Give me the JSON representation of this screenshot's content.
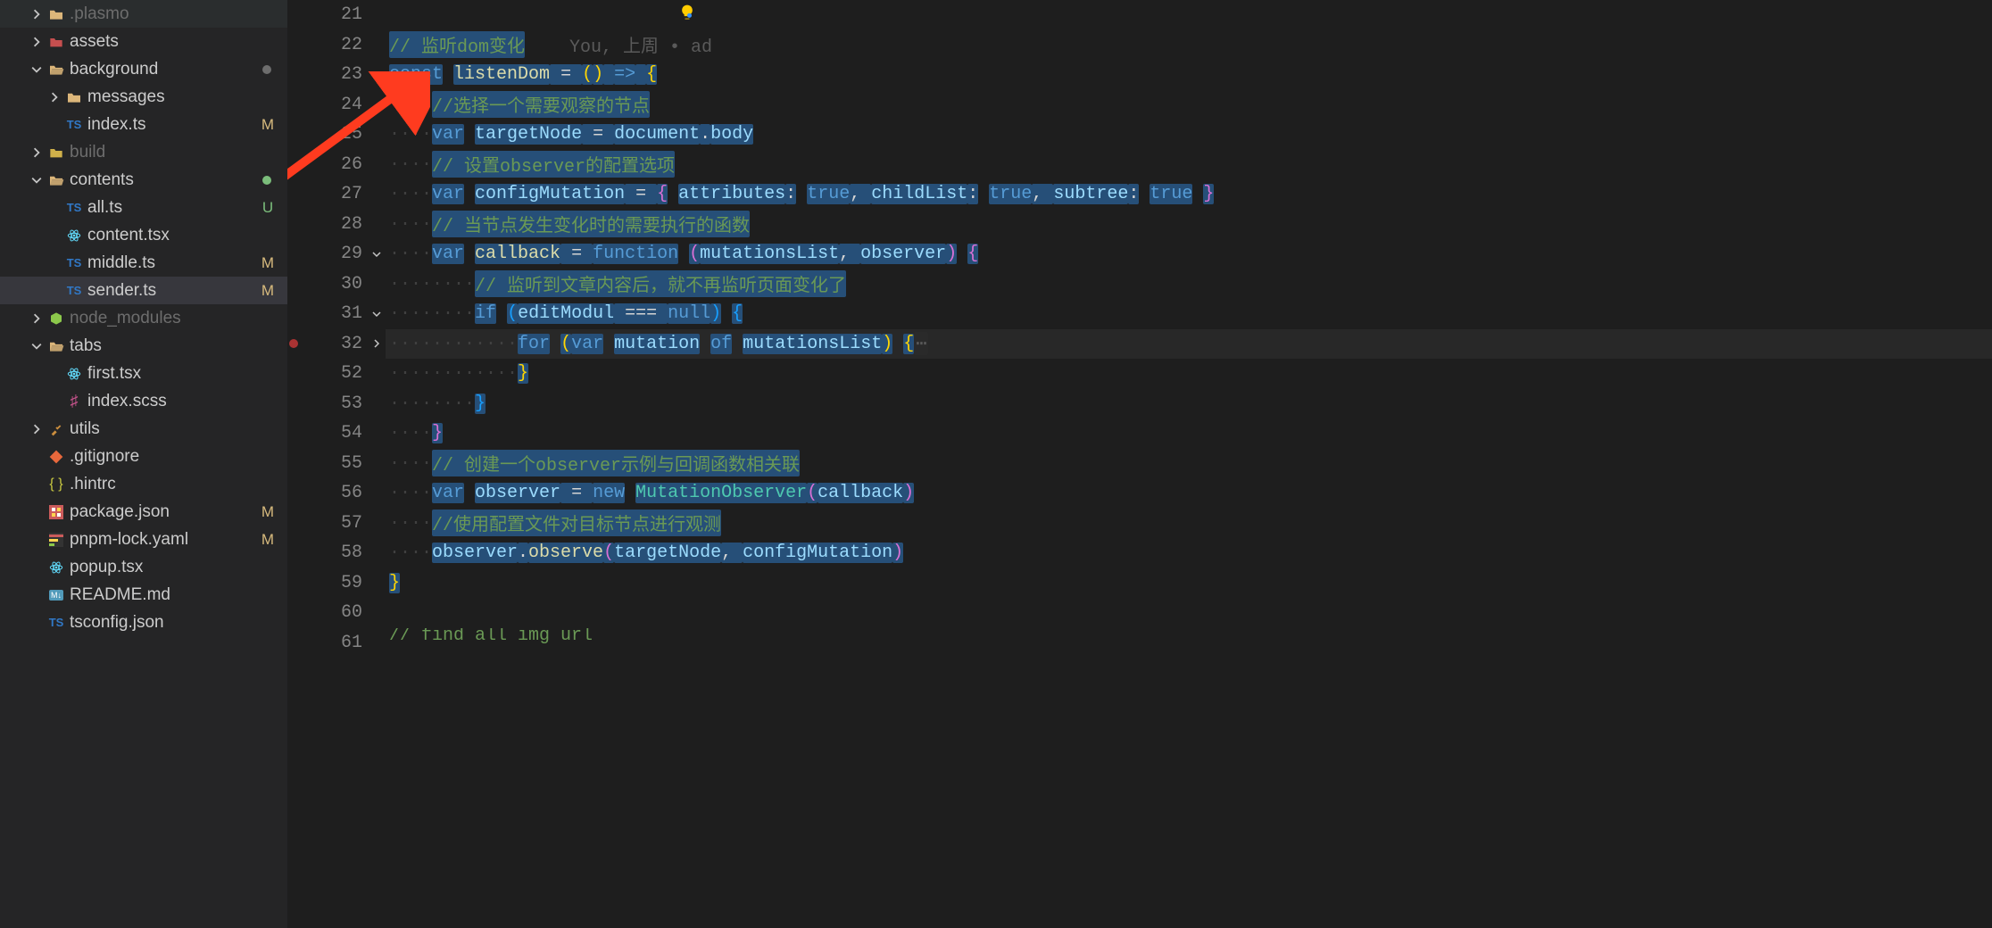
{
  "sidebar": {
    "items": [
      {
        "label": ".plasmo",
        "indent": 1,
        "chev": "right",
        "iconType": "folder",
        "status": "",
        "dimmed": true
      },
      {
        "label": "assets",
        "indent": 1,
        "chev": "right",
        "iconType": "assets",
        "status": ""
      },
      {
        "label": "background",
        "indent": 1,
        "chev": "down",
        "iconType": "folder-open",
        "dot": "#6d6d6d"
      },
      {
        "label": "messages",
        "indent": 2,
        "chev": "right",
        "iconType": "folder"
      },
      {
        "label": "index.ts",
        "indent": 2,
        "chev": "",
        "iconType": "ts",
        "status": "M",
        "statusColor": "#d7ba7d"
      },
      {
        "label": "build",
        "indent": 1,
        "chev": "right",
        "iconType": "build",
        "dimmed": true
      },
      {
        "label": "contents",
        "indent": 1,
        "chev": "down",
        "iconType": "folder-open",
        "dot": "#7bbd7b"
      },
      {
        "label": "all.ts",
        "indent": 2,
        "chev": "",
        "iconType": "ts",
        "status": "U",
        "statusColor": "#7bbd7b"
      },
      {
        "label": "content.tsx",
        "indent": 2,
        "chev": "",
        "iconType": "react"
      },
      {
        "label": "middle.ts",
        "indent": 2,
        "chev": "",
        "iconType": "ts",
        "status": "M",
        "statusColor": "#d7ba7d"
      },
      {
        "label": "sender.ts",
        "indent": 2,
        "chev": "",
        "iconType": "ts",
        "status": "M",
        "statusColor": "#d7ba7d",
        "active": true
      },
      {
        "label": "node_modules",
        "indent": 1,
        "chev": "right",
        "iconType": "node",
        "dimmed": true
      },
      {
        "label": "tabs",
        "indent": 1,
        "chev": "down",
        "iconType": "folder-open"
      },
      {
        "label": "first.tsx",
        "indent": 2,
        "chev": "",
        "iconType": "react"
      },
      {
        "label": "index.scss",
        "indent": 2,
        "chev": "",
        "iconType": "scss"
      },
      {
        "label": "utils",
        "indent": 1,
        "chev": "right",
        "iconType": "utils"
      },
      {
        "label": ".gitignore",
        "indent": 1,
        "chev": "",
        "iconType": "git"
      },
      {
        "label": ".hintrc",
        "indent": 1,
        "chev": "",
        "iconType": "json"
      },
      {
        "label": "package.json",
        "indent": 1,
        "chev": "",
        "iconType": "json2",
        "status": "M",
        "statusColor": "#d7ba7d"
      },
      {
        "label": "pnpm-lock.yaml",
        "indent": 1,
        "chev": "",
        "iconType": "yaml",
        "status": "M",
        "statusColor": "#d7ba7d"
      },
      {
        "label": "popup.tsx",
        "indent": 1,
        "chev": "",
        "iconType": "react"
      },
      {
        "label": "README.md",
        "indent": 1,
        "chev": "",
        "iconType": "md"
      },
      {
        "label": "tsconfig.json",
        "indent": 1,
        "chev": "",
        "iconType": "ts"
      }
    ]
  },
  "editor": {
    "blame": {
      "author": "You",
      "when": "上周",
      "sep": "•",
      "msg": "ad"
    },
    "lines": [
      {
        "no": 21,
        "tokens": []
      },
      {
        "no": 22,
        "blame": true,
        "tokens": [
          {
            "t": "// 监听dom变化",
            "c": "tk-comment",
            "sel": true
          }
        ]
      },
      {
        "no": 23,
        "fold": "down",
        "tokens": [
          {
            "t": "const",
            "c": "tk-kw",
            "sel": true
          },
          {
            "t": " "
          },
          {
            "t": "listenDom",
            "c": "tk-func",
            "sel": true
          },
          {
            "t": " = ",
            "sel": true
          },
          {
            "t": "(",
            "c": "tk-brace-y",
            "sel": true
          },
          {
            "t": ")",
            "c": "tk-brace-y",
            "sel": true
          },
          {
            "t": " ",
            "sel": true
          },
          {
            "t": "=>",
            "c": "tk-kw",
            "sel": true
          },
          {
            "t": " ",
            "sel": true
          },
          {
            "t": "{",
            "c": "tk-brace-y",
            "sel": true
          }
        ]
      },
      {
        "no": 24,
        "indent": 1,
        "tokens": [
          {
            "t": "//选择一个需要观察的节点",
            "c": "tk-comment",
            "sel": true
          }
        ]
      },
      {
        "no": 25,
        "indent": 1,
        "tokens": [
          {
            "t": "var",
            "c": "tk-kw",
            "sel": true
          },
          {
            "t": " "
          },
          {
            "t": "targetNode",
            "c": "tk-var",
            "sel": true
          },
          {
            "t": " = ",
            "sel": true
          },
          {
            "t": "document",
            "c": "tk-var",
            "sel": true
          },
          {
            "t": ".",
            "sel": true
          },
          {
            "t": "body",
            "c": "tk-var",
            "sel": true
          }
        ]
      },
      {
        "no": 26,
        "indent": 1,
        "tokens": [
          {
            "t": "// 设置observer的配置选项",
            "c": "tk-comment",
            "sel": true
          }
        ]
      },
      {
        "no": 27,
        "indent": 1,
        "tokens": [
          {
            "t": "var",
            "c": "tk-kw",
            "sel": true
          },
          {
            "t": " "
          },
          {
            "t": "configMutation",
            "c": "tk-var",
            "sel": true
          },
          {
            "t": " = ",
            "sel": true
          },
          {
            "t": "{",
            "c": "tk-brace-p",
            "sel": true
          },
          {
            "t": " "
          },
          {
            "t": "attributes",
            "c": "tk-var",
            "sel": true
          },
          {
            "t": ":",
            "sel": true
          },
          {
            "t": " "
          },
          {
            "t": "true",
            "c": "tk-const",
            "sel": true
          },
          {
            "t": ", ",
            "sel": true
          },
          {
            "t": "childList",
            "c": "tk-var",
            "sel": true
          },
          {
            "t": ":",
            "sel": true
          },
          {
            "t": " "
          },
          {
            "t": "true",
            "c": "tk-const",
            "sel": true
          },
          {
            "t": ", ",
            "sel": true
          },
          {
            "t": "subtree",
            "c": "tk-var",
            "sel": true
          },
          {
            "t": ":",
            "sel": true
          },
          {
            "t": " "
          },
          {
            "t": "true",
            "c": "tk-const",
            "sel": true
          },
          {
            "t": " "
          },
          {
            "t": "}",
            "c": "tk-brace-p",
            "sel": true
          }
        ]
      },
      {
        "no": 28,
        "indent": 1,
        "tokens": [
          {
            "t": "// 当节点发生变化时的需要执行的函数",
            "c": "tk-comment",
            "sel": true
          }
        ]
      },
      {
        "no": 29,
        "fold": "down",
        "indent": 1,
        "tokens": [
          {
            "t": "var",
            "c": "tk-kw",
            "sel": true
          },
          {
            "t": " "
          },
          {
            "t": "callback",
            "c": "tk-func",
            "sel": true
          },
          {
            "t": " = ",
            "sel": true
          },
          {
            "t": "function",
            "c": "tk-kw",
            "sel": true
          },
          {
            "t": " "
          },
          {
            "t": "(",
            "c": "tk-brace-p",
            "sel": true
          },
          {
            "t": "mutationsList",
            "c": "tk-var",
            "sel": true
          },
          {
            "t": ", ",
            "sel": true
          },
          {
            "t": "observer",
            "c": "tk-var",
            "sel": true
          },
          {
            "t": ")",
            "c": "tk-brace-p",
            "sel": true
          },
          {
            "t": " "
          },
          {
            "t": "{",
            "c": "tk-brace-p",
            "sel": true
          }
        ]
      },
      {
        "no": 30,
        "indent": 2,
        "tokens": [
          {
            "t": "// 监听到文章内容后，就不再监听页面变化了",
            "c": "tk-comment",
            "sel": true
          }
        ]
      },
      {
        "no": 31,
        "fold": "down",
        "indent": 2,
        "tokens": [
          {
            "t": "if",
            "c": "tk-kw",
            "sel": true
          },
          {
            "t": " "
          },
          {
            "t": "(",
            "c": "tk-brace-b",
            "sel": true
          },
          {
            "t": "editModul",
            "c": "tk-var",
            "sel": true
          },
          {
            "t": " === ",
            "sel": true
          },
          {
            "t": "null",
            "c": "tk-const",
            "sel": true
          },
          {
            "t": ")",
            "c": "tk-brace-b",
            "sel": true
          },
          {
            "t": " "
          },
          {
            "t": "{",
            "c": "tk-brace-b",
            "sel": true
          }
        ]
      },
      {
        "no": 32,
        "fold": "right",
        "bp": true,
        "indent": 3,
        "cur": true,
        "tokens": [
          {
            "t": "for",
            "c": "tk-kw",
            "sel": true
          },
          {
            "t": " "
          },
          {
            "t": "(",
            "c": "tk-brace-y",
            "sel": true
          },
          {
            "t": "var",
            "c": "tk-kw",
            "sel": true
          },
          {
            "t": " "
          },
          {
            "t": "mutation",
            "c": "tk-var",
            "sel": true
          },
          {
            "t": " "
          },
          {
            "t": "of",
            "c": "tk-kw",
            "sel": true
          },
          {
            "t": " "
          },
          {
            "t": "mutationsList",
            "c": "tk-var",
            "sel": true
          },
          {
            "t": ")",
            "c": "tk-brace-y",
            "sel": true
          },
          {
            "t": " "
          },
          {
            "t": "{",
            "c": "tk-brace-y",
            "sel": true
          },
          {
            "t": "⋯",
            "c": "folded-ph"
          }
        ]
      },
      {
        "no": 52,
        "indent": 3,
        "tokens": [
          {
            "t": "}",
            "c": "tk-brace-y",
            "sel": true
          }
        ]
      },
      {
        "no": 53,
        "indent": 2,
        "tokens": [
          {
            "t": "}",
            "c": "tk-brace-b",
            "sel": true
          }
        ]
      },
      {
        "no": 54,
        "indent": 1,
        "tokens": [
          {
            "t": "}",
            "c": "tk-brace-p",
            "sel": true
          }
        ]
      },
      {
        "no": 55,
        "indent": 1,
        "tokens": [
          {
            "t": "// 创建一个observer示例与回调函数相关联",
            "c": "tk-comment",
            "sel": true
          }
        ]
      },
      {
        "no": 56,
        "indent": 1,
        "tokens": [
          {
            "t": "var",
            "c": "tk-kw",
            "sel": true
          },
          {
            "t": " "
          },
          {
            "t": "observer",
            "c": "tk-var",
            "sel": true
          },
          {
            "t": " = ",
            "sel": true
          },
          {
            "t": "new",
            "c": "tk-kw",
            "sel": true
          },
          {
            "t": " "
          },
          {
            "t": "MutationObserver",
            "c": "tk-type",
            "sel": true
          },
          {
            "t": "(",
            "c": "tk-brace-p",
            "sel": true
          },
          {
            "t": "callback",
            "c": "tk-var",
            "sel": true
          },
          {
            "t": ")",
            "c": "tk-brace-p",
            "sel": true
          }
        ]
      },
      {
        "no": 57,
        "indent": 1,
        "tokens": [
          {
            "t": "//使用配置文件对目标节点进行观测",
            "c": "tk-comment",
            "sel": true
          }
        ]
      },
      {
        "no": 58,
        "indent": 1,
        "tokens": [
          {
            "t": "observer",
            "c": "tk-var",
            "sel": true
          },
          {
            "t": ".",
            "sel": true
          },
          {
            "t": "observe",
            "c": "tk-func",
            "sel": true
          },
          {
            "t": "(",
            "c": "tk-brace-p",
            "sel": true
          },
          {
            "t": "targetNode",
            "c": "tk-var",
            "sel": true
          },
          {
            "t": ", ",
            "sel": true
          },
          {
            "t": "configMutation",
            "c": "tk-var",
            "sel": true
          },
          {
            "t": ")",
            "c": "tk-brace-p",
            "sel": true
          }
        ]
      },
      {
        "no": 59,
        "tokens": [
          {
            "t": "}",
            "c": "tk-brace-y",
            "sel": true
          }
        ]
      },
      {
        "no": 60,
        "tokens": []
      },
      {
        "no": 61,
        "partial": true,
        "tokens": [
          {
            "t": "// find all img url",
            "c": "tk-comment"
          }
        ]
      }
    ]
  }
}
